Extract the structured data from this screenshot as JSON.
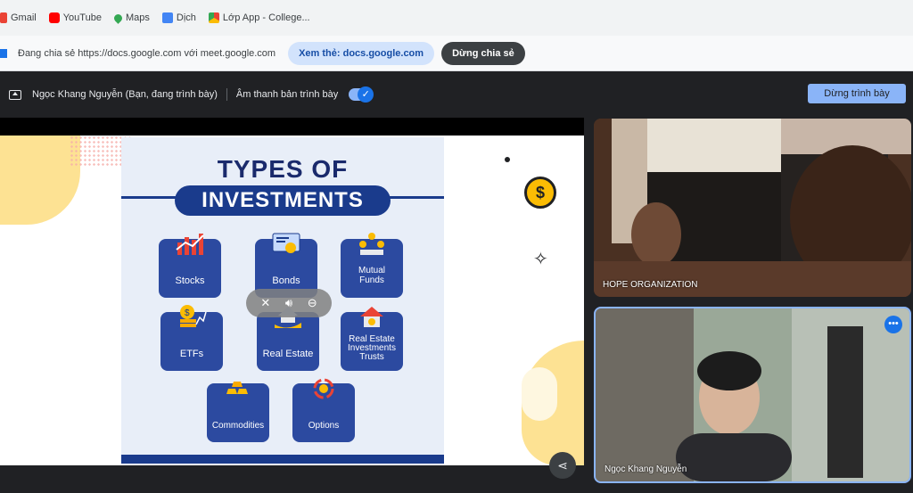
{
  "bookmarks": [
    {
      "label": "Gmail",
      "icon": "gmail-icon",
      "color": "#ea4335"
    },
    {
      "label": "YouTube",
      "icon": "youtube-icon",
      "color": "#ff0000"
    },
    {
      "label": "Maps",
      "icon": "maps-icon",
      "color": "#34a853"
    },
    {
      "label": "Dịch",
      "icon": "translate-icon",
      "color": "#4285f4"
    },
    {
      "label": "Lớp App - College...",
      "icon": "lop-app-icon",
      "color": "#fbbc04"
    }
  ],
  "share_banner": {
    "text": "Đang chia sẻ https://docs.google.com với meet.google.com",
    "view_label": "Xem thẻ: docs.google.com",
    "stop_label": "Dừng chia sẻ"
  },
  "present_bar": {
    "presenter": "Ngọc Khang Nguyễn (Bạn, đang trình bày)",
    "audio_label": "Âm thanh bản trình bày",
    "stop_label": "Dừng trình bày"
  },
  "slide": {
    "title": "TYPES OF",
    "subtitle": "INVESTMENTS",
    "cards": [
      {
        "label": "Stocks"
      },
      {
        "label": "Bonds"
      },
      {
        "label": "Mutual\nFunds"
      },
      {
        "label": "ETFs"
      },
      {
        "label": "Real Estate"
      },
      {
        "label": "Real Estate\nInvestments\nTrusts"
      },
      {
        "label": "Commodities"
      },
      {
        "label": "Options"
      }
    ],
    "coin_symbol": "$"
  },
  "participants": [
    {
      "name": "HOPE ORGANIZATION"
    },
    {
      "name": "Ngọc Khang Nguyễn"
    }
  ],
  "colors": {
    "meet_blue": "#8ab4f8",
    "poster_navy": "#1a3b8c",
    "accent_yellow": "#fde293"
  }
}
